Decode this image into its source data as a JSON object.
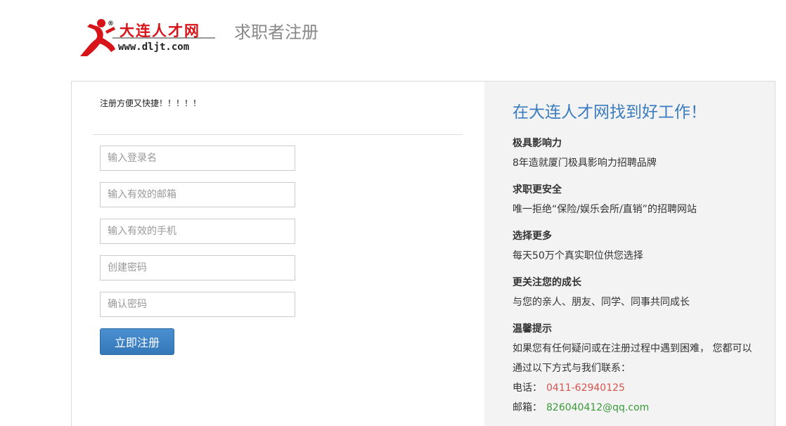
{
  "header": {
    "logo_cn": "大连人才网",
    "logo_url": "www.dljt.com",
    "page_title": "求职者注册"
  },
  "form": {
    "intro": "注册方便又快捷！！！！！",
    "fields": [
      {
        "placeholder": "输入登录名",
        "value": ""
      },
      {
        "placeholder": "输入有效的邮箱",
        "value": ""
      },
      {
        "placeholder": "输入有效的手机",
        "value": ""
      },
      {
        "placeholder": "创建密码",
        "value": ""
      },
      {
        "placeholder": "确认密码",
        "value": ""
      }
    ],
    "submit_label": "立即注册"
  },
  "info": {
    "title": "在大连人才网找到好工作！",
    "features": [
      {
        "title": "极具影响力",
        "desc": "8年造就厦门极具影响力招聘品牌"
      },
      {
        "title": "求职更安全",
        "desc": "唯一拒绝“保险/娱乐会所/直销”的招聘网站"
      },
      {
        "title": "选择更多",
        "desc": "每天50万个真实职位供您选择"
      },
      {
        "title": "更关注您的成长",
        "desc": "与您的亲人、朋友、同学、同事共同成长"
      }
    ],
    "tips": {
      "title": "温馨提示",
      "line1": "如果您有任何疑问或在注册过程中遇到困难， 您都可以",
      "line2": "通过以下方式与我们联系：",
      "phone_label": "电话：",
      "phone": "0411-62940125",
      "email_label": "邮箱：",
      "email": "826040412@qq.com"
    }
  },
  "colors": {
    "accent_blue": "#3a7cc0",
    "button_blue": "#3478b8",
    "phone_red": "#d9534f",
    "email_green": "#3a9a3a",
    "logo_red": "#d7141a"
  }
}
